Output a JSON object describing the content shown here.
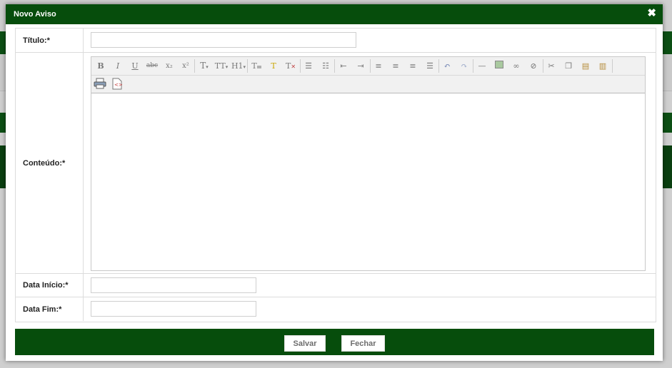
{
  "modal": {
    "title": "Novo Aviso",
    "close_glyph": "✖"
  },
  "fields": {
    "titulo_label": "Título:*",
    "conteudo_label": "Conteúdo:*",
    "data_inicio_label": "Data Início:*",
    "data_fim_label": "Data Fim:*",
    "titulo_value": "",
    "data_inicio_value": "",
    "data_fim_value": ""
  },
  "toolbar": {
    "bold": "B",
    "italic": "I",
    "underline": "U",
    "strike": "abc",
    "subscript": "x₂",
    "superscript": "x²",
    "font": "T",
    "font_size": "TT",
    "heading": "H1",
    "icons": [
      "bold-icon",
      "italic-icon",
      "underline-icon",
      "strikethrough-icon",
      "subscript-icon",
      "superscript-icon",
      "font-family-icon",
      "font-size-icon",
      "heading-icon",
      "font-color-icon",
      "highlight-icon",
      "remove-format-icon",
      "unordered-list-icon",
      "ordered-list-icon",
      "outdent-icon",
      "indent-icon",
      "align-left-icon",
      "align-center-icon",
      "align-right-icon",
      "justify-icon",
      "undo-icon",
      "redo-icon",
      "horizontal-rule-icon",
      "table-icon",
      "link-icon",
      "unlink-icon",
      "cut-icon",
      "copy-icon",
      "paste-icon",
      "paste-text-icon",
      "print-icon",
      "source-code-icon"
    ]
  },
  "buttons": {
    "save": "Salvar",
    "close": "Fechar"
  },
  "colors": {
    "header_green": "#064d0c",
    "button_text": "#6d6d6d"
  }
}
